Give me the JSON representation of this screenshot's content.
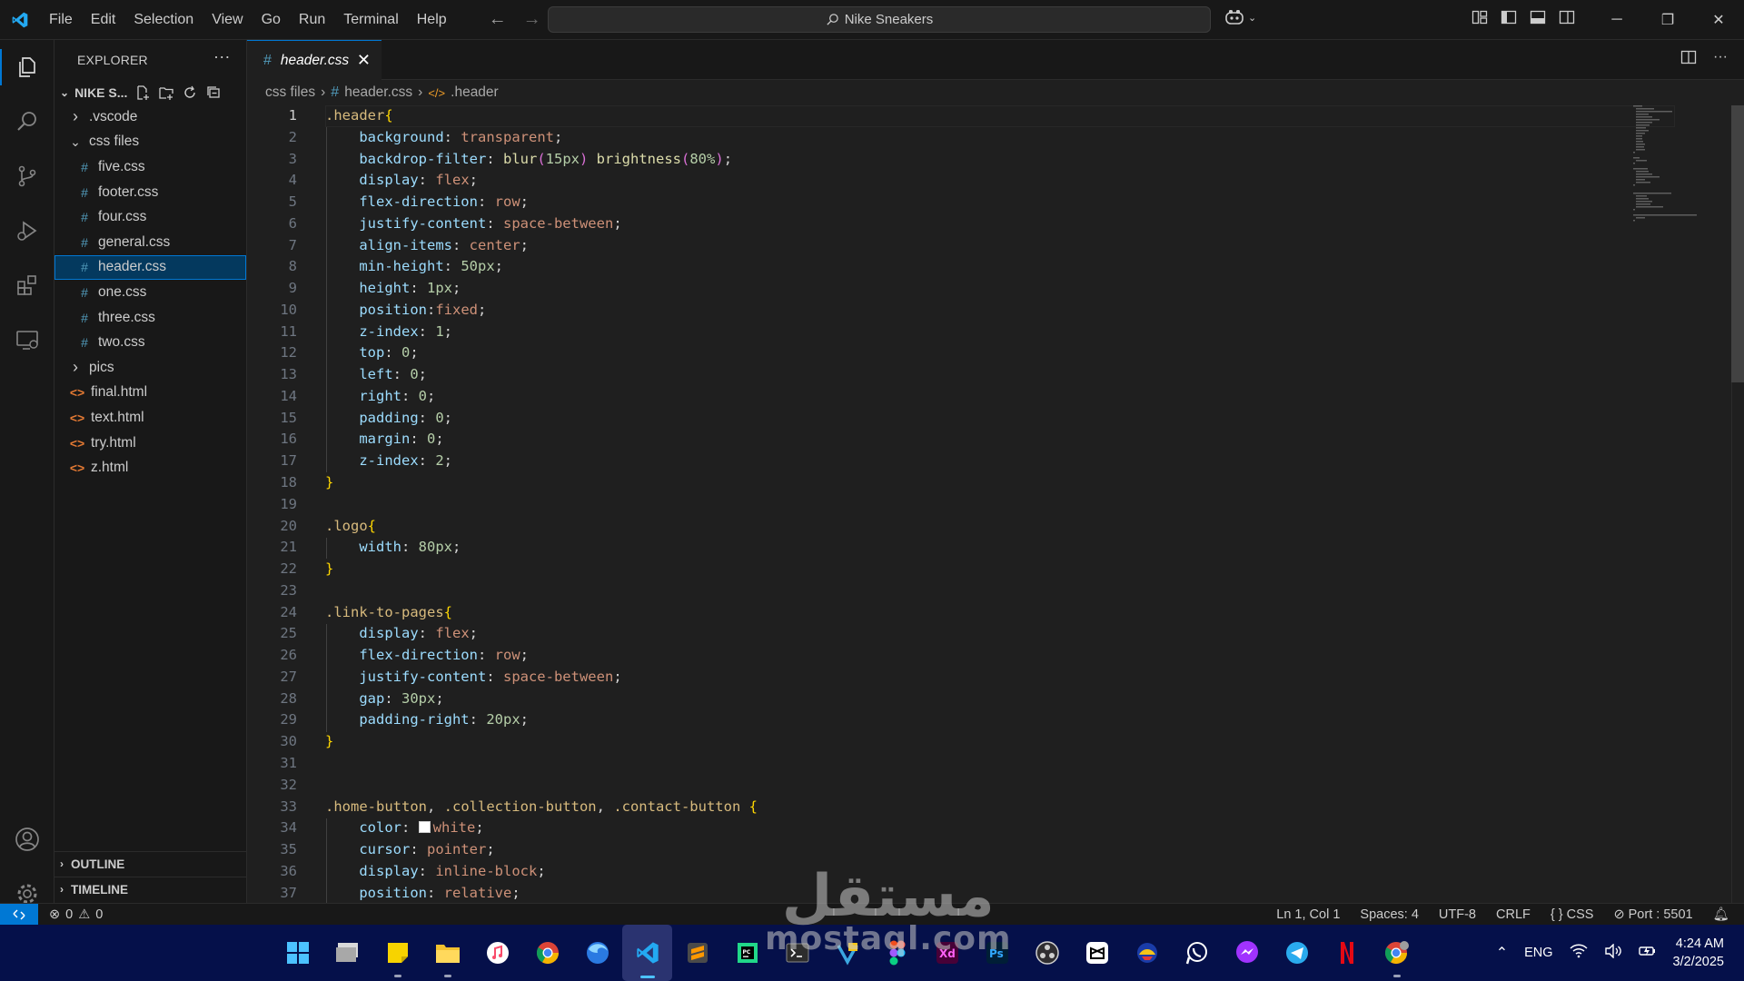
{
  "menu": [
    "File",
    "Edit",
    "Selection",
    "View",
    "Go",
    "Run",
    "Terminal",
    "Help"
  ],
  "command_center": "Nike Sneakers",
  "explorer": {
    "title": "EXPLORER",
    "folder": "NIKE S...",
    "items": [
      {
        "label": ".vscode",
        "kind": "folder",
        "expanded": false,
        "depth": 0
      },
      {
        "label": "css files",
        "kind": "folder",
        "expanded": true,
        "depth": 0
      },
      {
        "label": "five.css",
        "kind": "css",
        "depth": 1
      },
      {
        "label": "footer.css",
        "kind": "css",
        "depth": 1
      },
      {
        "label": "four.css",
        "kind": "css",
        "depth": 1
      },
      {
        "label": "general.css",
        "kind": "css",
        "depth": 1
      },
      {
        "label": "header.css",
        "kind": "css",
        "depth": 1,
        "selected": true
      },
      {
        "label": "one.css",
        "kind": "css",
        "depth": 1
      },
      {
        "label": "three.css",
        "kind": "css",
        "depth": 1
      },
      {
        "label": "two.css",
        "kind": "css",
        "depth": 1
      },
      {
        "label": "pics",
        "kind": "folder",
        "expanded": false,
        "depth": 0
      },
      {
        "label": "final.html",
        "kind": "html",
        "depth": 0
      },
      {
        "label": "text.html",
        "kind": "html",
        "depth": 0
      },
      {
        "label": "try.html",
        "kind": "html",
        "depth": 0
      },
      {
        "label": "z.html",
        "kind": "html",
        "depth": 0
      }
    ],
    "outline": "OUTLINE",
    "timeline": "TIMELINE"
  },
  "tab": {
    "label": "header.css",
    "close": "✕"
  },
  "breadcrumb": {
    "folder": "css files",
    "file": "header.css",
    "symbol": ".header"
  },
  "code_lines": [
    [
      [
        "t-sel",
        ".header"
      ],
      [
        "t-brace",
        "{"
      ]
    ],
    [
      [
        "t-p",
        "    "
      ],
      [
        "t-prop",
        "background"
      ],
      [
        "t-p",
        ": "
      ],
      [
        "t-val",
        "transparent"
      ],
      [
        "t-p",
        ";"
      ]
    ],
    [
      [
        "t-p",
        "    "
      ],
      [
        "t-prop",
        "backdrop-filter"
      ],
      [
        "t-p",
        ": "
      ],
      [
        "t-fn",
        "blur"
      ],
      [
        "t-pn",
        "("
      ],
      [
        "t-num",
        "15px"
      ],
      [
        "t-pn",
        ")"
      ],
      [
        "t-p",
        " "
      ],
      [
        "t-fn",
        "brightness"
      ],
      [
        "t-pn",
        "("
      ],
      [
        "t-num",
        "80%"
      ],
      [
        "t-pn",
        ")"
      ],
      [
        "t-p",
        ";"
      ]
    ],
    [
      [
        "t-p",
        "    "
      ],
      [
        "t-prop",
        "display"
      ],
      [
        "t-p",
        ": "
      ],
      [
        "t-val",
        "flex"
      ],
      [
        "t-p",
        ";"
      ]
    ],
    [
      [
        "t-p",
        "    "
      ],
      [
        "t-prop",
        "flex-direction"
      ],
      [
        "t-p",
        ": "
      ],
      [
        "t-val",
        "row"
      ],
      [
        "t-p",
        ";"
      ]
    ],
    [
      [
        "t-p",
        "    "
      ],
      [
        "t-prop",
        "justify-content"
      ],
      [
        "t-p",
        ": "
      ],
      [
        "t-val",
        "space-between"
      ],
      [
        "t-p",
        ";"
      ]
    ],
    [
      [
        "t-p",
        "    "
      ],
      [
        "t-prop",
        "align-items"
      ],
      [
        "t-p",
        ": "
      ],
      [
        "t-val",
        "center"
      ],
      [
        "t-p",
        ";"
      ]
    ],
    [
      [
        "t-p",
        "    "
      ],
      [
        "t-prop",
        "min-height"
      ],
      [
        "t-p",
        ": "
      ],
      [
        "t-num",
        "50px"
      ],
      [
        "t-p",
        ";"
      ]
    ],
    [
      [
        "t-p",
        "    "
      ],
      [
        "t-prop",
        "height"
      ],
      [
        "t-p",
        ": "
      ],
      [
        "t-num",
        "1px"
      ],
      [
        "t-p",
        ";"
      ]
    ],
    [
      [
        "t-p",
        "    "
      ],
      [
        "t-prop",
        "position"
      ],
      [
        "t-p",
        ":"
      ],
      [
        "t-val",
        "fixed"
      ],
      [
        "t-p",
        ";"
      ]
    ],
    [
      [
        "t-p",
        "    "
      ],
      [
        "t-prop",
        "z-index"
      ],
      [
        "t-p",
        ": "
      ],
      [
        "t-num",
        "1"
      ],
      [
        "t-p",
        ";"
      ]
    ],
    [
      [
        "t-p",
        "    "
      ],
      [
        "t-prop",
        "top"
      ],
      [
        "t-p",
        ": "
      ],
      [
        "t-num",
        "0"
      ],
      [
        "t-p",
        ";"
      ]
    ],
    [
      [
        "t-p",
        "    "
      ],
      [
        "t-prop",
        "left"
      ],
      [
        "t-p",
        ": "
      ],
      [
        "t-num",
        "0"
      ],
      [
        "t-p",
        ";"
      ]
    ],
    [
      [
        "t-p",
        "    "
      ],
      [
        "t-prop",
        "right"
      ],
      [
        "t-p",
        ": "
      ],
      [
        "t-num",
        "0"
      ],
      [
        "t-p",
        ";"
      ]
    ],
    [
      [
        "t-p",
        "    "
      ],
      [
        "t-prop",
        "padding"
      ],
      [
        "t-p",
        ": "
      ],
      [
        "t-num",
        "0"
      ],
      [
        "t-p",
        ";"
      ]
    ],
    [
      [
        "t-p",
        "    "
      ],
      [
        "t-prop",
        "margin"
      ],
      [
        "t-p",
        ": "
      ],
      [
        "t-num",
        "0"
      ],
      [
        "t-p",
        ";"
      ]
    ],
    [
      [
        "t-p",
        "    "
      ],
      [
        "t-prop",
        "z-index"
      ],
      [
        "t-p",
        ": "
      ],
      [
        "t-num",
        "2"
      ],
      [
        "t-p",
        ";"
      ]
    ],
    [
      [
        "t-brace",
        "}"
      ]
    ],
    [],
    [
      [
        "t-sel",
        ".logo"
      ],
      [
        "t-brace",
        "{"
      ]
    ],
    [
      [
        "t-p",
        "    "
      ],
      [
        "t-prop",
        "width"
      ],
      [
        "t-p",
        ": "
      ],
      [
        "t-num",
        "80px"
      ],
      [
        "t-p",
        ";"
      ]
    ],
    [
      [
        "t-brace",
        "}"
      ]
    ],
    [],
    [
      [
        "t-sel",
        ".link-to-pages"
      ],
      [
        "t-brace",
        "{"
      ]
    ],
    [
      [
        "t-p",
        "    "
      ],
      [
        "t-prop",
        "display"
      ],
      [
        "t-p",
        ": "
      ],
      [
        "t-val",
        "flex"
      ],
      [
        "t-p",
        ";"
      ]
    ],
    [
      [
        "t-p",
        "    "
      ],
      [
        "t-prop",
        "flex-direction"
      ],
      [
        "t-p",
        ": "
      ],
      [
        "t-val",
        "row"
      ],
      [
        "t-p",
        ";"
      ]
    ],
    [
      [
        "t-p",
        "    "
      ],
      [
        "t-prop",
        "justify-content"
      ],
      [
        "t-p",
        ": "
      ],
      [
        "t-val",
        "space-between"
      ],
      [
        "t-p",
        ";"
      ]
    ],
    [
      [
        "t-p",
        "    "
      ],
      [
        "t-prop",
        "gap"
      ],
      [
        "t-p",
        ": "
      ],
      [
        "t-num",
        "30px"
      ],
      [
        "t-p",
        ";"
      ]
    ],
    [
      [
        "t-p",
        "    "
      ],
      [
        "t-prop",
        "padding-right"
      ],
      [
        "t-p",
        ": "
      ],
      [
        "t-num",
        "20px"
      ],
      [
        "t-p",
        ";"
      ]
    ],
    [
      [
        "t-brace",
        "}"
      ]
    ],
    [],
    [],
    [
      [
        "t-sel",
        ".home-button"
      ],
      [
        "t-p",
        ", "
      ],
      [
        "t-sel",
        ".collection-button"
      ],
      [
        "t-p",
        ", "
      ],
      [
        "t-sel",
        ".contact-button"
      ],
      [
        "t-p",
        " "
      ],
      [
        "t-brace",
        "{"
      ]
    ],
    [
      [
        "t-p",
        "    "
      ],
      [
        "t-prop",
        "color"
      ],
      [
        "t-p",
        ": "
      ],
      [
        "swatch",
        ""
      ],
      [
        "t-val",
        "white"
      ],
      [
        "t-p",
        ";"
      ]
    ],
    [
      [
        "t-p",
        "    "
      ],
      [
        "t-prop",
        "cursor"
      ],
      [
        "t-p",
        ": "
      ],
      [
        "t-val",
        "pointer"
      ],
      [
        "t-p",
        ";"
      ]
    ],
    [
      [
        "t-p",
        "    "
      ],
      [
        "t-prop",
        "display"
      ],
      [
        "t-p",
        ": "
      ],
      [
        "t-val",
        "inline-block"
      ],
      [
        "t-p",
        ";"
      ]
    ],
    [
      [
        "t-p",
        "    "
      ],
      [
        "t-prop",
        "position"
      ],
      [
        "t-p",
        ": "
      ],
      [
        "t-val",
        "relative"
      ],
      [
        "t-p",
        ";"
      ]
    ]
  ],
  "current_line": 1,
  "status": {
    "errors": "0",
    "warnings": "0",
    "position": "Ln 1, Col 1",
    "spaces": "Spaces: 4",
    "encoding": "UTF-8",
    "eol": "CRLF",
    "language": "CSS",
    "port": "Port : 5501"
  },
  "taskbar": {
    "apps": [
      "windows-start",
      "desktop-app",
      "sticky-notes",
      "file-explorer",
      "itunes",
      "chrome",
      "firefox",
      "vscode",
      "sublime-text",
      "pycharm",
      "terminal",
      "vs-app",
      "figma",
      "adobe-xd",
      "photoshop",
      "obs",
      "capcut",
      "app-red-yellow",
      "whatsapp",
      "messenger",
      "telegram",
      "netflix",
      "chrome-profile"
    ],
    "language": "ENG",
    "time": "4:24 AM",
    "date": "3/2/2025"
  },
  "watermark": {
    "arabic": "مستقل",
    "latin": "mostaql.com"
  },
  "colors": {
    "accent": "#0078d4",
    "selector": "#d7ba7d",
    "property": "#9cdcfe",
    "value": "#ce9178",
    "number": "#b5cea8",
    "taskbar": "#05104a"
  }
}
